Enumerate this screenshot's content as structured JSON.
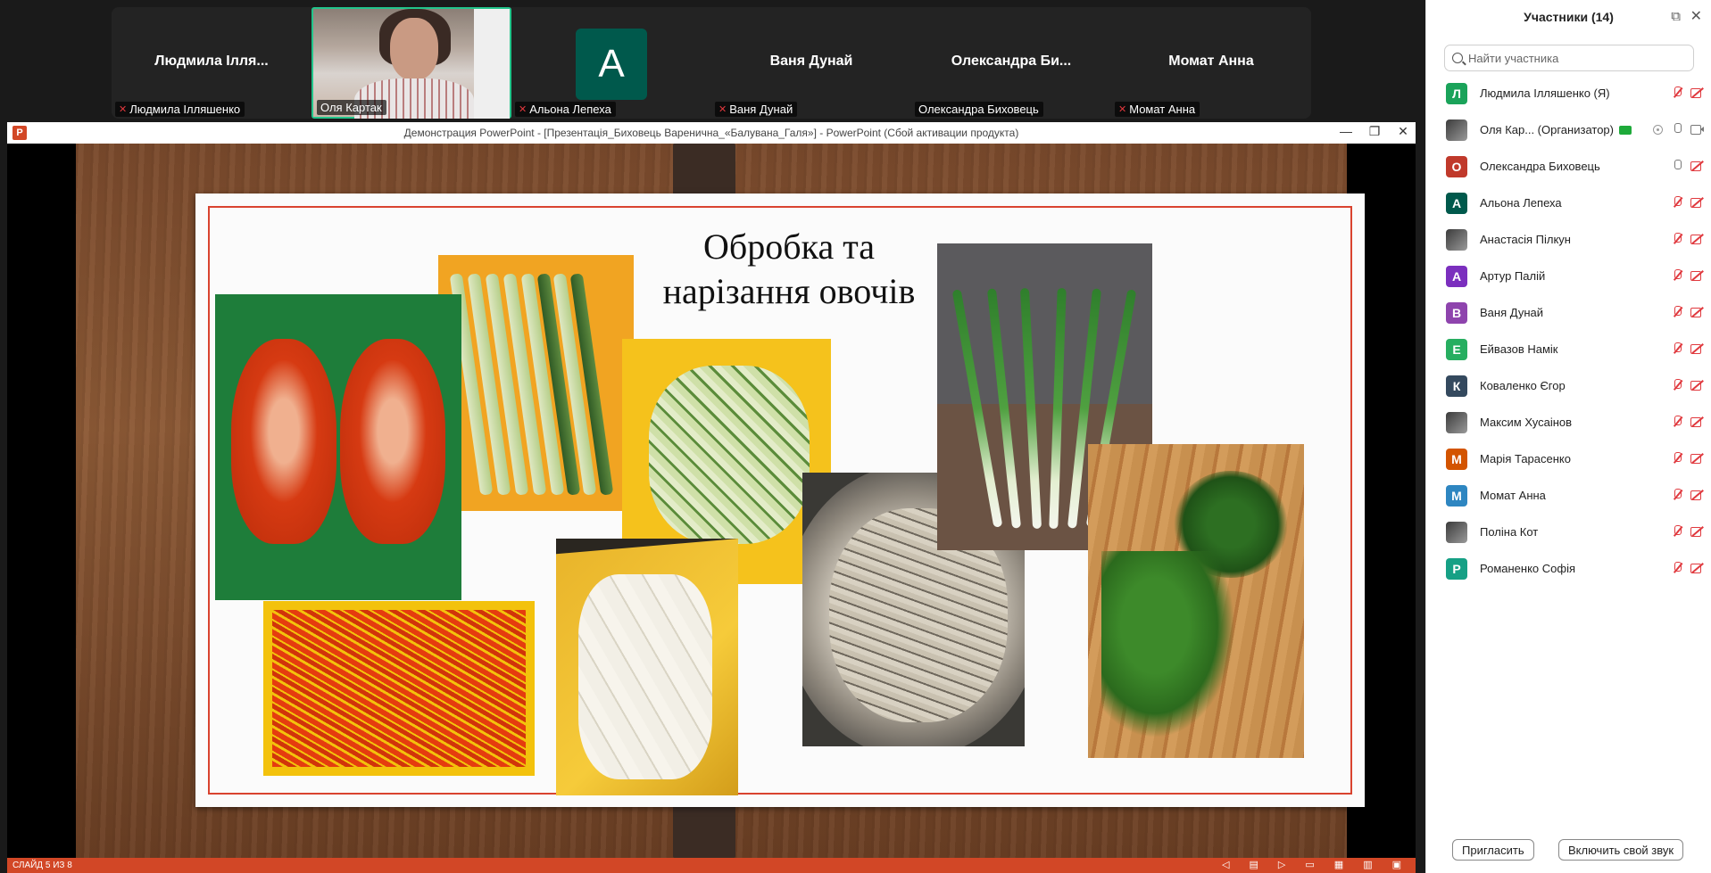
{
  "colors": {
    "accent_green": "#22c58b",
    "ppt_red": "#d24726",
    "muted_red": "#e0393e",
    "frame_red": "#d9432f"
  },
  "video_strip": {
    "tiles": [
      {
        "big_name": "Людмила Ілля...",
        "tag": "Людмила Ілляшенко",
        "mic": "mic-muted-icon"
      },
      {
        "big_name": "",
        "tag": "Оля Картак",
        "mic": "",
        "video": true,
        "active": true
      },
      {
        "big_name": "",
        "avatar": "А",
        "tag": "Альона Лепеха",
        "mic": "mic-muted-icon"
      },
      {
        "big_name": "Ваня Дунай",
        "tag": "Ваня Дунай",
        "mic": "mic-muted-icon"
      },
      {
        "big_name": "Олександра Би...",
        "tag": "Олександра Биховець",
        "mic": ""
      },
      {
        "big_name": "Момат Анна",
        "tag": "Момат Анна",
        "mic": "mic-muted-icon"
      }
    ]
  },
  "ppt": {
    "window_title": "Демонстрация PowerPoint - [Презентація_Биховець Вареничнa_«Балувана_Галя»] - PowerPoint (Сбой активации продукта)",
    "app_icon_letter": "P",
    "slide_title_line1": "Обробка та",
    "slide_title_line2": "нарізання овочів",
    "status_text": "СЛАЙД 5 ИЗ 8"
  },
  "panel": {
    "title": "Участники (14)",
    "search_placeholder": "Найти участника",
    "invite_label": "Пригласить",
    "unmute_label": "Включить свой звук",
    "participants": [
      {
        "initial": "Л",
        "name": "Людмила Ілляшенко (Я)",
        "color": "#1aa35a",
        "mic": "muted",
        "cam": "off"
      },
      {
        "initial": "",
        "name": "Оля Кар... (Организатор)",
        "color": "#888888",
        "photo": true,
        "mic": "on",
        "cam": "on",
        "badge": true
      },
      {
        "initial": "О",
        "name": "Олександра Биховець",
        "color": "#c0392b",
        "mic": "on",
        "cam": "off"
      },
      {
        "initial": "А",
        "name": "Альона Лепеха",
        "color": "#00594c",
        "mic": "muted",
        "cam": "off"
      },
      {
        "initial": "",
        "name": "Анастасія Пілкун",
        "color": "#555555",
        "photo": true,
        "mic": "muted",
        "cam": "off"
      },
      {
        "initial": "А",
        "name": "Артур Палій",
        "color": "#7b2fbe",
        "mic": "muted",
        "cam": "off"
      },
      {
        "initial": "В",
        "name": "Ваня Дунай",
        "color": "#8e44ad",
        "mic": "muted",
        "cam": "off"
      },
      {
        "initial": "Е",
        "name": "Ейвазов Намік",
        "color": "#27ae60",
        "mic": "muted",
        "cam": "off"
      },
      {
        "initial": "К",
        "name": "Коваленко Єгор",
        "color": "#34495e",
        "mic": "muted",
        "cam": "off"
      },
      {
        "initial": "",
        "name": "Максим Хусаінов",
        "color": "#444444",
        "photo": true,
        "mic": "muted",
        "cam": "off"
      },
      {
        "initial": "М",
        "name": "Марія Тарасенко",
        "color": "#d35400",
        "mic": "muted",
        "cam": "off"
      },
      {
        "initial": "М",
        "name": "Момат Анна",
        "color": "#2e86c1",
        "mic": "muted",
        "cam": "off"
      },
      {
        "initial": "",
        "name": "Поліна Кот",
        "color": "#222244",
        "photo": true,
        "mic": "muted",
        "cam": "off"
      },
      {
        "initial": "Р",
        "name": "Романенко Софія",
        "color": "#16a085",
        "mic": "muted",
        "cam": "off"
      }
    ]
  }
}
